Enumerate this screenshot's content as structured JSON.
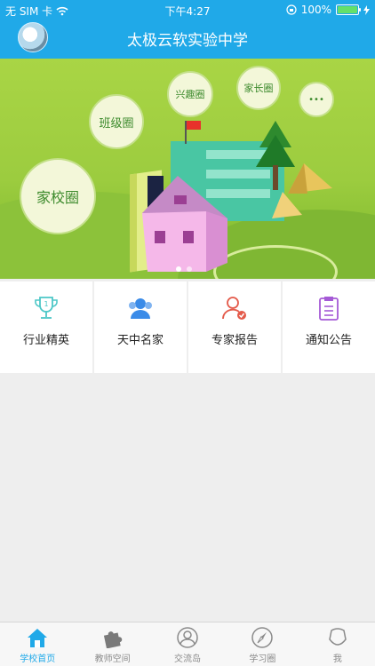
{
  "status": {
    "carrier": "无 SIM 卡",
    "time": "下午4:27",
    "battery": "100%",
    "battery_level": 1.0,
    "icons": [
      "wifi-icon",
      "orientation-lock-icon",
      "battery-icon",
      "charging-icon"
    ]
  },
  "header": {
    "title": "太极云软实验中学"
  },
  "banner": {
    "bubbles": [
      "家校圈",
      "班级圈",
      "兴趣圈",
      "家长圈",
      "•••"
    ],
    "slide_count": 2,
    "active_slide": 1
  },
  "menu": [
    {
      "label": "行业精英",
      "icon": "trophy-icon",
      "color": "#4cc7c7"
    },
    {
      "label": "天中名家",
      "icon": "group-icon",
      "color": "#3a8be8"
    },
    {
      "label": "专家报告",
      "icon": "verified-user-icon",
      "color": "#e45a4a"
    },
    {
      "label": "通知公告",
      "icon": "clipboard-icon",
      "color": "#a55ad6"
    }
  ],
  "tabs": [
    {
      "label": "学校首页",
      "icon": "home-icon",
      "active": true
    },
    {
      "label": "教师空间",
      "icon": "puzzle-icon",
      "active": false
    },
    {
      "label": "交流岛",
      "icon": "user-circle-icon",
      "active": false
    },
    {
      "label": "学习圈",
      "icon": "compass-icon",
      "active": false
    },
    {
      "label": "我",
      "icon": "person-icon",
      "active": false
    }
  ],
  "colors": {
    "accent": "#20a9e8",
    "inactive": "#8a8a8a"
  }
}
